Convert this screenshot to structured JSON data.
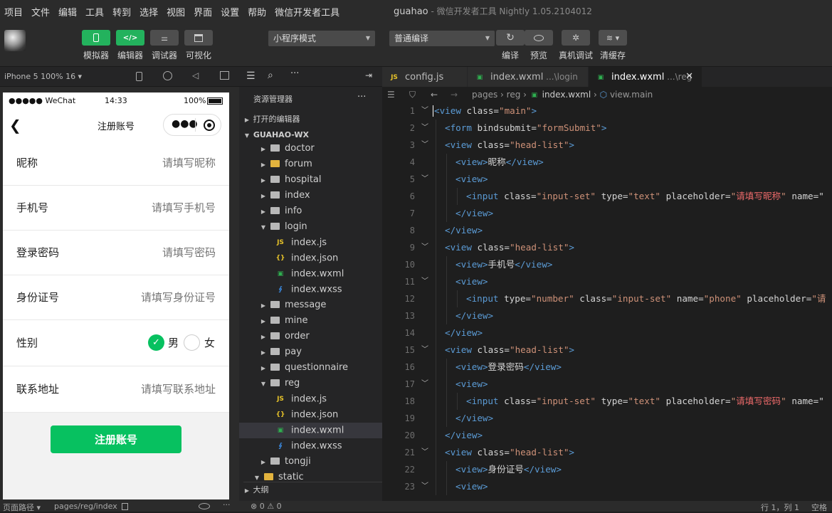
{
  "menu": [
    "项目",
    "文件",
    "编辑",
    "工具",
    "转到",
    "选择",
    "视图",
    "界面",
    "设置",
    "帮助",
    "微信开发者工具"
  ],
  "window_title": {
    "app": "guahao",
    "sep": " - ",
    "product": "微信开发者工具 Nightly 1.05.2104012"
  },
  "toolbar": {
    "simulator": "模拟器",
    "editor": "编辑器",
    "debugger": "调试器",
    "visual": "可视化",
    "mode": "小程序模式",
    "compile": "普通编译",
    "compile_btn": "编译",
    "preview": "预览",
    "remote_debug": "真机调试",
    "clear_cache": "清缓存"
  },
  "simulator": {
    "device": "iPhone 5 100% 16 ▾",
    "status": {
      "carrier": "●●●●● WeChat",
      "time": "14:33",
      "battery": "100%"
    },
    "nav_title": "注册账号",
    "rows": [
      {
        "label": "昵称",
        "placeholder": "请填写昵称"
      },
      {
        "label": "手机号",
        "placeholder": "请填写手机号"
      },
      {
        "label": "登录密码",
        "placeholder": "请填写密码"
      },
      {
        "label": "身份证号",
        "placeholder": "请填写身份证号"
      },
      {
        "label": "联系地址",
        "placeholder": "请填写联系地址"
      }
    ],
    "gender": {
      "label": "性别",
      "male": "男",
      "female": "女",
      "selected": "男"
    },
    "submit": "注册账号",
    "footer": {
      "path_label": "页面路径 ▾",
      "path": "pages/reg/index"
    }
  },
  "explorer": {
    "title": "资源管理器",
    "open_editors": "打开的编辑器",
    "project": "GUAHAO-WX",
    "outline": "大纲",
    "tree": [
      {
        "name": "doctor",
        "kind": "folder",
        "open": false
      },
      {
        "name": "forum",
        "kind": "folder",
        "open": false
      },
      {
        "name": "hospital",
        "kind": "folder",
        "open": false
      },
      {
        "name": "index",
        "kind": "folder",
        "open": false
      },
      {
        "name": "info",
        "kind": "folder",
        "open": false
      },
      {
        "name": "login",
        "kind": "folder",
        "open": true
      },
      {
        "name": "index.js",
        "kind": "js",
        "indent": 2
      },
      {
        "name": "index.json",
        "kind": "json",
        "indent": 2
      },
      {
        "name": "index.wxml",
        "kind": "wxml",
        "indent": 2
      },
      {
        "name": "index.wxss",
        "kind": "wxss",
        "indent": 2
      },
      {
        "name": "message",
        "kind": "folder",
        "open": false
      },
      {
        "name": "mine",
        "kind": "folder",
        "open": false
      },
      {
        "name": "order",
        "kind": "folder",
        "open": false
      },
      {
        "name": "pay",
        "kind": "folder",
        "open": false
      },
      {
        "name": "questionnaire",
        "kind": "folder",
        "open": false
      },
      {
        "name": "reg",
        "kind": "folder",
        "open": true
      },
      {
        "name": "index.js",
        "kind": "js",
        "indent": 2
      },
      {
        "name": "index.json",
        "kind": "json",
        "indent": 2
      },
      {
        "name": "index.wxml",
        "kind": "wxml",
        "indent": 2,
        "selected": true
      },
      {
        "name": "index.wxss",
        "kind": "wxss",
        "indent": 2
      },
      {
        "name": "tongji",
        "kind": "folder",
        "open": false
      },
      {
        "name": "static",
        "kind": "folder",
        "open": true,
        "level": 0
      }
    ],
    "footer": "⊗ 0 ⚠ 0"
  },
  "editor": {
    "tabs": [
      {
        "name": "config.js",
        "kind": "js",
        "hint": ""
      },
      {
        "name": "index.wxml",
        "kind": "wxml",
        "hint": " ...\\login"
      },
      {
        "name": "index.wxml",
        "kind": "wxml",
        "hint": " ...\\reg",
        "active": true
      }
    ],
    "breadcrumb": [
      "pages",
      "reg",
      "index.wxml",
      "view.main"
    ],
    "lines": [
      {
        "n": 1,
        "fold": true,
        "indent": 0,
        "parts": [
          [
            "t",
            "<view "
          ],
          [
            "a",
            "class="
          ],
          [
            "s",
            "\"main\""
          ],
          [
            "t",
            ">"
          ]
        ]
      },
      {
        "n": 2,
        "fold": true,
        "indent": 1,
        "parts": [
          [
            "t",
            "<form "
          ],
          [
            "a",
            "bindsubmit="
          ],
          [
            "s",
            "\"formSubmit\""
          ],
          [
            "t",
            ">"
          ]
        ]
      },
      {
        "n": 3,
        "fold": true,
        "indent": 1,
        "parts": [
          [
            "t",
            "<view "
          ],
          [
            "a",
            "class="
          ],
          [
            "s",
            "\"head-list\""
          ],
          [
            "t",
            ">"
          ]
        ]
      },
      {
        "n": 4,
        "fold": false,
        "indent": 2,
        "parts": [
          [
            "t",
            "<view>"
          ],
          [
            "a",
            "昵称"
          ],
          [
            "t",
            "</view>"
          ]
        ]
      },
      {
        "n": 5,
        "fold": true,
        "indent": 2,
        "parts": [
          [
            "t",
            "<view>"
          ]
        ]
      },
      {
        "n": 6,
        "fold": false,
        "indent": 3,
        "parts": [
          [
            "t",
            "<input "
          ],
          [
            "a",
            "class="
          ],
          [
            "s",
            "\"input-set\" "
          ],
          [
            "a",
            "type="
          ],
          [
            "s",
            "\"text\" "
          ],
          [
            "a",
            "placeholder="
          ],
          [
            "s",
            "\""
          ],
          [
            "cn",
            "请填写昵称"
          ],
          [
            "s",
            "\" "
          ],
          [
            "a",
            "name=\""
          ]
        ]
      },
      {
        "n": 7,
        "fold": false,
        "indent": 2,
        "parts": [
          [
            "t",
            "</view>"
          ]
        ]
      },
      {
        "n": 8,
        "fold": false,
        "indent": 1,
        "parts": [
          [
            "t",
            "</view>"
          ]
        ]
      },
      {
        "n": 9,
        "fold": true,
        "indent": 1,
        "parts": [
          [
            "t",
            "<view "
          ],
          [
            "a",
            "class="
          ],
          [
            "s",
            "\"head-list\""
          ],
          [
            "t",
            ">"
          ]
        ]
      },
      {
        "n": 10,
        "fold": false,
        "indent": 2,
        "parts": [
          [
            "t",
            "<view>"
          ],
          [
            "a",
            "手机号"
          ],
          [
            "t",
            "</view>"
          ]
        ]
      },
      {
        "n": 11,
        "fold": true,
        "indent": 2,
        "parts": [
          [
            "t",
            "<view>"
          ]
        ]
      },
      {
        "n": 12,
        "fold": false,
        "indent": 3,
        "parts": [
          [
            "t",
            "<input "
          ],
          [
            "a",
            "type="
          ],
          [
            "s",
            "\"number\" "
          ],
          [
            "a",
            "class="
          ],
          [
            "s",
            "\"input-set\" "
          ],
          [
            "a",
            "name="
          ],
          [
            "s",
            "\"phone\" "
          ],
          [
            "a",
            "placeholder="
          ],
          [
            "s",
            "\"请"
          ]
        ]
      },
      {
        "n": 13,
        "fold": false,
        "indent": 2,
        "parts": [
          [
            "t",
            "</view>"
          ]
        ]
      },
      {
        "n": 14,
        "fold": false,
        "indent": 1,
        "parts": [
          [
            "t",
            "</view>"
          ]
        ]
      },
      {
        "n": 15,
        "fold": true,
        "indent": 1,
        "parts": [
          [
            "t",
            "<view "
          ],
          [
            "a",
            "class="
          ],
          [
            "s",
            "\"head-list\""
          ],
          [
            "t",
            ">"
          ]
        ]
      },
      {
        "n": 16,
        "fold": false,
        "indent": 2,
        "parts": [
          [
            "t",
            "<view>"
          ],
          [
            "a",
            "登录密码"
          ],
          [
            "t",
            "</view>"
          ]
        ]
      },
      {
        "n": 17,
        "fold": true,
        "indent": 2,
        "parts": [
          [
            "t",
            "<view>"
          ]
        ]
      },
      {
        "n": 18,
        "fold": false,
        "indent": 3,
        "parts": [
          [
            "t",
            "<input "
          ],
          [
            "a",
            "class="
          ],
          [
            "s",
            "\"input-set\" "
          ],
          [
            "a",
            "type="
          ],
          [
            "s",
            "\"text\" "
          ],
          [
            "a",
            "placeholder="
          ],
          [
            "s",
            "\""
          ],
          [
            "cn",
            "请填写密码"
          ],
          [
            "s",
            "\" "
          ],
          [
            "a",
            "name=\""
          ]
        ]
      },
      {
        "n": 19,
        "fold": false,
        "indent": 2,
        "parts": [
          [
            "t",
            "</view>"
          ]
        ]
      },
      {
        "n": 20,
        "fold": false,
        "indent": 1,
        "parts": [
          [
            "t",
            "</view>"
          ]
        ]
      },
      {
        "n": 21,
        "fold": true,
        "indent": 1,
        "parts": [
          [
            "t",
            "<view "
          ],
          [
            "a",
            "class="
          ],
          [
            "s",
            "\"head-list\""
          ],
          [
            "t",
            ">"
          ]
        ]
      },
      {
        "n": 22,
        "fold": false,
        "indent": 2,
        "parts": [
          [
            "t",
            "<view>"
          ],
          [
            "a",
            "身份证号"
          ],
          [
            "t",
            "</view>"
          ]
        ]
      },
      {
        "n": 23,
        "fold": true,
        "indent": 2,
        "parts": [
          [
            "t",
            "<view>"
          ]
        ]
      }
    ],
    "status": {
      "position": "行 1，列 1",
      "indent": "空格"
    }
  },
  "colors": {
    "accent": "#07c160",
    "toolbar_green": "#23b25d",
    "editor_bg": "#1e1e1e"
  }
}
